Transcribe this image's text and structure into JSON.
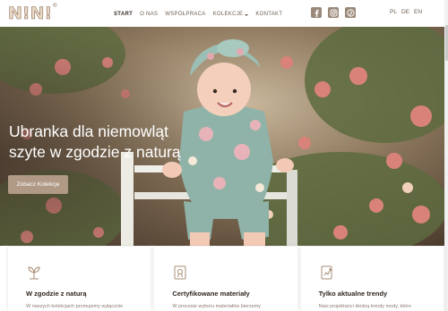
{
  "brand": {
    "logo_text": "N!N!",
    "registered": "®"
  },
  "nav": {
    "items": [
      {
        "label": "START",
        "active": true
      },
      {
        "label": "O NAS",
        "active": false
      },
      {
        "label": "WSPÓŁPRACA",
        "active": false
      },
      {
        "label": "KOLEKCJE",
        "active": false,
        "dropdown": true
      },
      {
        "label": "KONTAKT",
        "active": false
      }
    ]
  },
  "socials": {
    "icons": [
      "facebook-icon",
      "instagram-icon",
      "pinterest-icon"
    ]
  },
  "languages": [
    "PL",
    "DE",
    "EN"
  ],
  "hero": {
    "title_line1": "Ubranka dla niemowląt",
    "title_line2": "szyte w zgodzie z naturą",
    "cta_label": "Zobacz Kolekcje"
  },
  "features": [
    {
      "icon": "plant-icon",
      "title": "W zgodzie z naturą",
      "text": "W naszych kolekcjach promujemy wyłącznie"
    },
    {
      "icon": "certificate-icon",
      "title": "Certyfikowane materiały",
      "text": "W procesie wyboru materiałów bierzemy"
    },
    {
      "icon": "trend-icon",
      "title": "Tylko aktualne trendy",
      "text": "Nasi projektanci śledzą trendy mody, które"
    }
  ],
  "colors": {
    "accent": "#b09a86",
    "text_dark": "#2f2620",
    "text_muted": "#8a7b6f"
  }
}
